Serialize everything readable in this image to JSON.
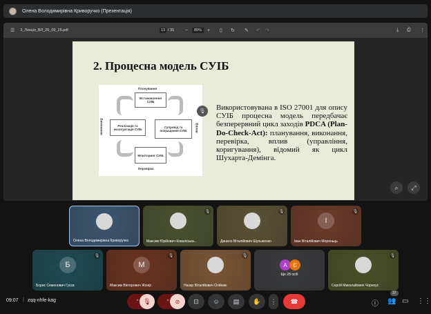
{
  "presenter": {
    "name": "Олена Володимирівна Криворучко (Презентація)"
  },
  "pdf": {
    "filename": "3_Лекція_ВЛ_25_09_25.pdf",
    "page": "13",
    "total": "/ 35",
    "zoom": "80%"
  },
  "slide": {
    "title": "2. Процесна модель СУІБ",
    "text_pre": "Використовувана в ISO 27001 для опису СУІБ процесна модель передбачає безперервний цикл заходів ",
    "text_bold": "PDCA (Plan-Do-Check-Act):",
    "text_post": " планування, виконання, перевірка, вплив (управління, коригування), відомий як цикл Шухарта-Демінга.",
    "diagram": {
      "plan": "Планування",
      "establish": "Встановлення СУІБ",
      "implement": "Реалізація та експлуатація СУІБ",
      "maintain": "Супровід та покращення СУІБ",
      "monitor": "Моніторинг СУІБ",
      "check": "Перевірка",
      "do": "Виконання",
      "act": "Вплив"
    }
  },
  "participants": [
    {
      "name": "Олена Володимирівна Криворучко",
      "initial": "",
      "bg": "#3d5670"
    },
    {
      "name": "Максим Юрійович Коваліська...",
      "initial": "",
      "bg": "#4a5230"
    },
    {
      "name": "Данило Віталійович Шульженко",
      "initial": "",
      "bg": "#5a5234"
    },
    {
      "name": "Іван Віталійович Мореньць",
      "initial": "І",
      "bg": "#6a3a28"
    },
    {
      "name": "Борис Семенович Гусєв",
      "initial": "Б",
      "bg": "#1f4a52"
    },
    {
      "name": "Максим Вікторович Жонір",
      "initial": "М",
      "bg": "#6a3320"
    },
    {
      "name": "Назар Віталійович Олійник",
      "initial": "",
      "bg": "#7a5535"
    },
    {
      "name": "Ще 28 осіб",
      "initial": "",
      "bg": "#3a3b3d"
    },
    {
      "name": "Сергій Миколайович Чорноус",
      "initial": "",
      "bg": "#4a5028"
    }
  ],
  "more": {
    "a": "А",
    "b": "Є"
  },
  "meeting": {
    "time": "09:07",
    "code": "zqq-nhfe-kag",
    "people_count": "37"
  }
}
